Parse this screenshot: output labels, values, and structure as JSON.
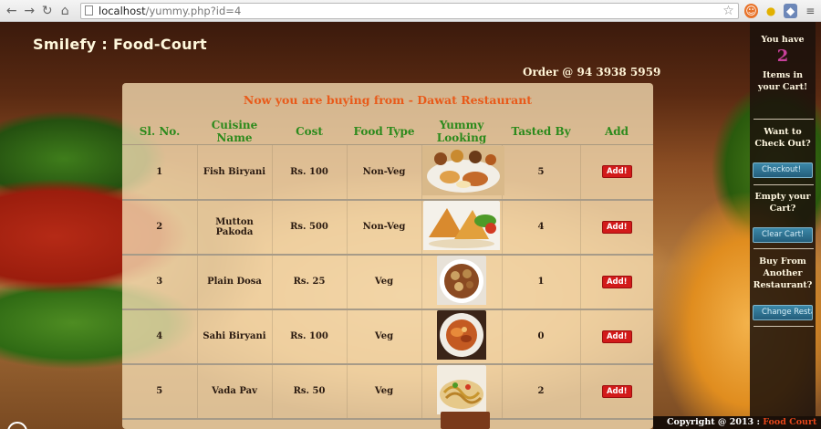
{
  "browser": {
    "url_host": "localhost",
    "url_path": "/yummy.php?id=4"
  },
  "site": {
    "title": "Smilefy : Food-Court",
    "order_phone": "Order @ 94 3938 5959"
  },
  "panel": {
    "heading": "Now you are buying from - Dawat Restaurant",
    "columns": [
      "Sl. No.",
      "Cuisine Name",
      "Cost",
      "Food Type",
      "Yummy Looking",
      "Tasted By",
      "Add"
    ],
    "rows": [
      {
        "sl": "1",
        "name": "Fish Biryani",
        "cost": "Rs. 100",
        "type": "Non-Veg",
        "tasted": "5",
        "add": "Add!",
        "image": "fish-biryani-thali"
      },
      {
        "sl": "2",
        "name": "Mutton Pakoda",
        "cost": "Rs. 500",
        "type": "Non-Veg",
        "tasted": "4",
        "add": "Add!",
        "image": "samosa-plate"
      },
      {
        "sl": "3",
        "name": "Plain Dosa",
        "cost": "Rs. 25",
        "type": "Veg",
        "tasted": "1",
        "add": "Add!",
        "image": "plain-dosa-bowl"
      },
      {
        "sl": "4",
        "name": "Sahi Biryani",
        "cost": "Rs. 100",
        "type": "Veg",
        "tasted": "0",
        "add": "Add!",
        "image": "sahi-biryani-plate"
      },
      {
        "sl": "5",
        "name": "Vada Pav",
        "cost": "Rs. 50",
        "type": "Veg",
        "tasted": "2",
        "add": "Add!",
        "image": "vada-pav-noodles"
      }
    ]
  },
  "cart": {
    "you_have": "You have",
    "count": "2",
    "items_line": "Items in your Cart!",
    "checkout_prompt": "Want to Check Out?",
    "checkout_button": "Checkout!",
    "empty_prompt": "Empty your Cart?",
    "clear_button": "Clear Cart!",
    "buy_other_prompt": "Buy From Another Restaurant?",
    "change_button": "Change Resta"
  },
  "footer": {
    "copyright": "Copyright @ 2013 : ",
    "brand": "Food Court"
  },
  "colors": {
    "heading": "#e85a1a",
    "column_header": "#2c8a1c",
    "add_button": "#d21a1a",
    "cart_count": "#c8409a",
    "side_button": "#2f7596"
  }
}
